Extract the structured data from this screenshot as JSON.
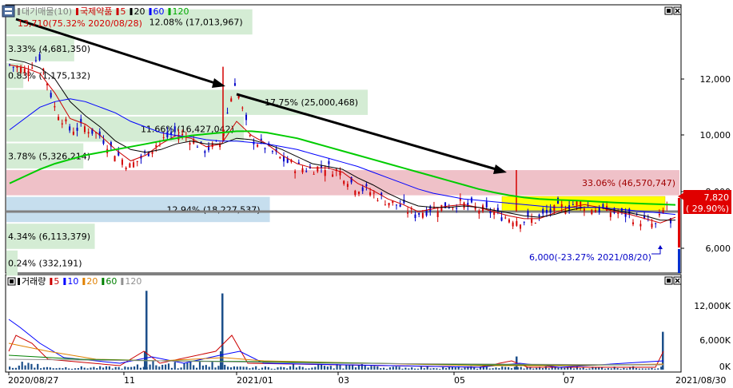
{
  "header": {
    "price_legend": {
      "items": [
        {
          "label": "대기매물(10)",
          "color": "#808080"
        },
        {
          "label": "국제약품",
          "color": "#cc0000"
        },
        {
          "label": "5",
          "color": "#cc0000"
        },
        {
          "label": "20",
          "color": "#000000"
        },
        {
          "label": "60",
          "color": "#0000ff"
        },
        {
          "label": "120",
          "color": "#00aa00"
        }
      ]
    },
    "high_annotation": "13,710(75.32% 2020/08/28)",
    "low_annotation": "6,000(-23.27% 2021/08/20)",
    "volume_legend": {
      "items": [
        {
          "label": "거래량",
          "color": "#000000"
        },
        {
          "label": "5",
          "color": "#cc0000"
        },
        {
          "label": "10",
          "color": "#0000ff"
        },
        {
          "label": "20",
          "color": "#e08000"
        },
        {
          "label": "60",
          "color": "#008000"
        },
        {
          "label": "120",
          "color": "#909090"
        }
      ]
    }
  },
  "current_price": {
    "value": "7,820",
    "change": "( 29.90%)"
  },
  "volume_profile": [
    {
      "label": "0.24% (332,191)",
      "color": "#d4ecd4"
    },
    {
      "label": "4.34% (6,113,379)",
      "color": "#d4ecd4"
    },
    {
      "label": "12.94% (18,227,537)",
      "color": "#c6deee"
    },
    {
      "label": "33.06% (46,570,747)",
      "color": "#efc1c8"
    },
    {
      "label": "3.78% (5,326,214)",
      "color": "#d4ecd4"
    },
    {
      "label": "11.66% (16,427,042)",
      "color": "#d4ecd4"
    },
    {
      "label": "17.75% (25,000,468)",
      "color": "#d4ecd4"
    },
    {
      "label": "0.83% (1,175,132)",
      "color": "#d4ecd4"
    },
    {
      "label": "3.33% (4,681,350)",
      "color": "#d4ecd4"
    },
    {
      "label": "12.08% (17,013,967)",
      "color": "#d4ecd4"
    }
  ],
  "colors": {
    "up": "#d40000",
    "down": "#0000c8",
    "ma5": "#cc0000",
    "ma20": "#000000",
    "ma60": "#0000ff",
    "ma120": "#00cc00",
    "highlight": "#ffff00",
    "horizontal_line": "#808080",
    "volume_bar": "#1c4f8a"
  },
  "icons": [
    "chart-type-icon",
    "maximize-icon",
    "close-icon"
  ],
  "chart_data": [
    {
      "type": "candlestick",
      "title": "국제약품",
      "x_tick_labels": [
        "2020/08/27",
        "11",
        "2021/01",
        "03",
        "05",
        "07",
        "2021/08/30"
      ],
      "y_tick_labels": [
        "12,000",
        "10,000",
        "8,000",
        "6,000"
      ],
      "ylim": [
        5000,
        14500
      ],
      "high": {
        "value": 13710,
        "date": "2020/08/28",
        "change_pct": 75.32
      },
      "low": {
        "value": 6000,
        "date": "2021/08/20",
        "change_pct": -23.27
      },
      "last": {
        "value": 7820,
        "change_pct": 29.9
      },
      "sampled_closes": [
        12500,
        12300,
        12800,
        11000,
        10200,
        10300,
        10000,
        9400,
        8900,
        9300,
        9800,
        10100,
        9900,
        9500,
        9700,
        11900,
        9900,
        9600,
        9200,
        8900,
        8800,
        8900,
        8700,
        8200,
        8000,
        7700,
        7500,
        7200,
        7400,
        7500,
        7600,
        7400,
        7300,
        7100,
        7000,
        7000,
        7300,
        7500,
        7600,
        7400,
        7300,
        7200,
        7000,
        6800,
        7820
      ],
      "series": [
        {
          "name": "5",
          "values": [
            12500,
            12400,
            12200,
            11500,
            10600,
            10400,
            10000,
            9500,
            9100,
            9300,
            9700,
            10000,
            9900,
            9600,
            9700,
            10500,
            10000,
            9700,
            9300,
            9000,
            8850,
            8850,
            8700,
            8300,
            8050,
            7750,
            7550,
            7300,
            7400,
            7500,
            7550,
            7450,
            7300,
            7150,
            7050,
            7050,
            7250,
            7450,
            7550,
            7450,
            7300,
            7200,
            7050,
            6900,
            7100
          ]
        },
        {
          "name": "20",
          "values": [
            12700,
            12600,
            12400,
            12000,
            11200,
            10700,
            10300,
            9800,
            9500,
            9400,
            9500,
            9700,
            9800,
            9700,
            9700,
            9900,
            9850,
            9700,
            9500,
            9250,
            9000,
            8900,
            8800,
            8500,
            8250,
            7950,
            7700,
            7500,
            7450,
            7450,
            7500,
            7450,
            7350,
            7250,
            7150,
            7100,
            7200,
            7350,
            7450,
            7450,
            7350,
            7250,
            7150,
            7000,
            7000
          ]
        },
        {
          "name": "60",
          "values": [
            10200,
            10600,
            11000,
            11200,
            11300,
            11200,
            11000,
            10800,
            10500,
            10300,
            10100,
            10000,
            9950,
            9850,
            9800,
            9800,
            9750,
            9700,
            9600,
            9500,
            9350,
            9200,
            9050,
            8900,
            8700,
            8500,
            8300,
            8100,
            7950,
            7850,
            7750,
            7700,
            7650,
            7600,
            7550,
            7500,
            7450,
            7450,
            7450,
            7450,
            7400,
            7350,
            7300,
            7250,
            7200
          ]
        },
        {
          "name": "120",
          "values": [
            8300,
            8550,
            8800,
            9000,
            9150,
            9300,
            9400,
            9500,
            9600,
            9700,
            9800,
            9900,
            10000,
            10050,
            10100,
            10150,
            10150,
            10100,
            10000,
            9900,
            9750,
            9600,
            9450,
            9300,
            9150,
            9000,
            8850,
            8700,
            8550,
            8400,
            8250,
            8100,
            7980,
            7880,
            7800,
            7750,
            7720,
            7700,
            7680,
            7650,
            7620,
            7600,
            7580,
            7560,
            7540
          ]
        }
      ]
    },
    {
      "type": "bar",
      "title": "거래량",
      "y_tick_labels": [
        "12,000K",
        "6,000K",
        "0K"
      ],
      "ylim": [
        0,
        16000
      ],
      "spikes_K": [
        {
          "date_approx": "2020/11",
          "value": 15000
        },
        {
          "date_approx": "2020/12",
          "value": 14500
        },
        {
          "date_approx": "2021/06",
          "value": 2500
        },
        {
          "date_approx": "2021/08/27",
          "value": 7200
        }
      ]
    }
  ]
}
